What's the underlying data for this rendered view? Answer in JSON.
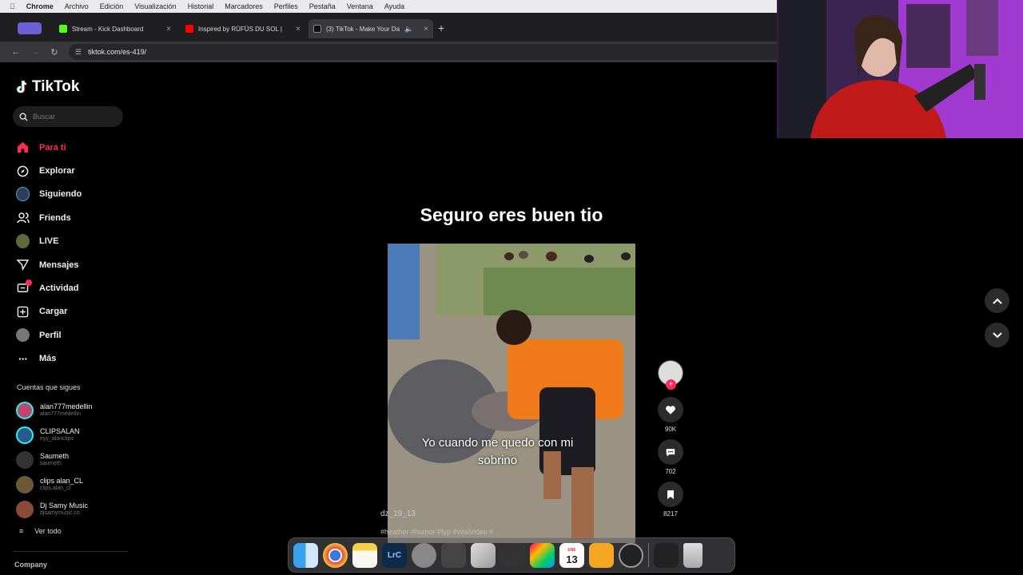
{
  "menubar": {
    "app": "Chrome",
    "items": [
      "Archivo",
      "Edición",
      "Visualización",
      "Historial",
      "Marcadores",
      "Perfiles",
      "Pestaña",
      "Ventana",
      "Ayuda"
    ]
  },
  "tabs": [
    {
      "label": "Stream - Kick Dashboard",
      "color": "#53fc18"
    },
    {
      "label": "Inspired by RÜFÜS DU SOL |",
      "color": "#ff0000"
    },
    {
      "label": "(3) TikTok - Make Your Da",
      "color": "#ffffff"
    }
  ],
  "address": {
    "url": "tiktok.com/es-419/"
  },
  "tiktok": {
    "logo": "TikTok",
    "search_placeholder": "Buscar",
    "nav": [
      {
        "label": "Para ti",
        "icon": "home-icon"
      },
      {
        "label": "Explorar",
        "icon": "compass-icon"
      },
      {
        "label": "Siguiendo",
        "icon": "following-avatar-icon"
      },
      {
        "label": "Friends",
        "icon": "friends-icon"
      },
      {
        "label": "LIVE",
        "icon": "live-avatar-icon"
      },
      {
        "label": "Mensajes",
        "icon": "send-icon"
      },
      {
        "label": "Actividad",
        "icon": "inbox-icon"
      },
      {
        "label": "Cargar",
        "icon": "upload-icon"
      },
      {
        "label": "Perfil",
        "icon": "profile-avatar-icon"
      },
      {
        "label": "Más",
        "icon": "more-icon"
      }
    ],
    "following_title": "Cuentas que sigues",
    "following": [
      {
        "name": "alan777medellin",
        "handle": "alan777medellin",
        "color": "#c04870"
      },
      {
        "name": "CLIPSALAN",
        "handle": "eyy_alanclips",
        "color": "#2a5a8a"
      },
      {
        "name": "Saumeth",
        "handle": "saumeth",
        "color": "#333333"
      },
      {
        "name": "clips alan_CL",
        "handle": "clips.alan_cl",
        "color": "#6a5a3a"
      },
      {
        "name": "Dj Samy Music",
        "handle": "djsamymusic.co",
        "color": "#8a4a3a"
      }
    ],
    "see_all": "Ver todo",
    "company": "Company"
  },
  "video": {
    "caption": "Seguro eres buen tio",
    "subtitle": "Yo cuando me quedo con mi sobrino",
    "author": "dz_19_13",
    "hashtags": "#heather #humor #fyp #viralvideo #"
  },
  "actions": {
    "likes": "90K",
    "comments": "702",
    "saves": "8217"
  },
  "dock": {
    "calendar_month": "ENE",
    "calendar_day": "13",
    "lightroom": "LrC"
  }
}
